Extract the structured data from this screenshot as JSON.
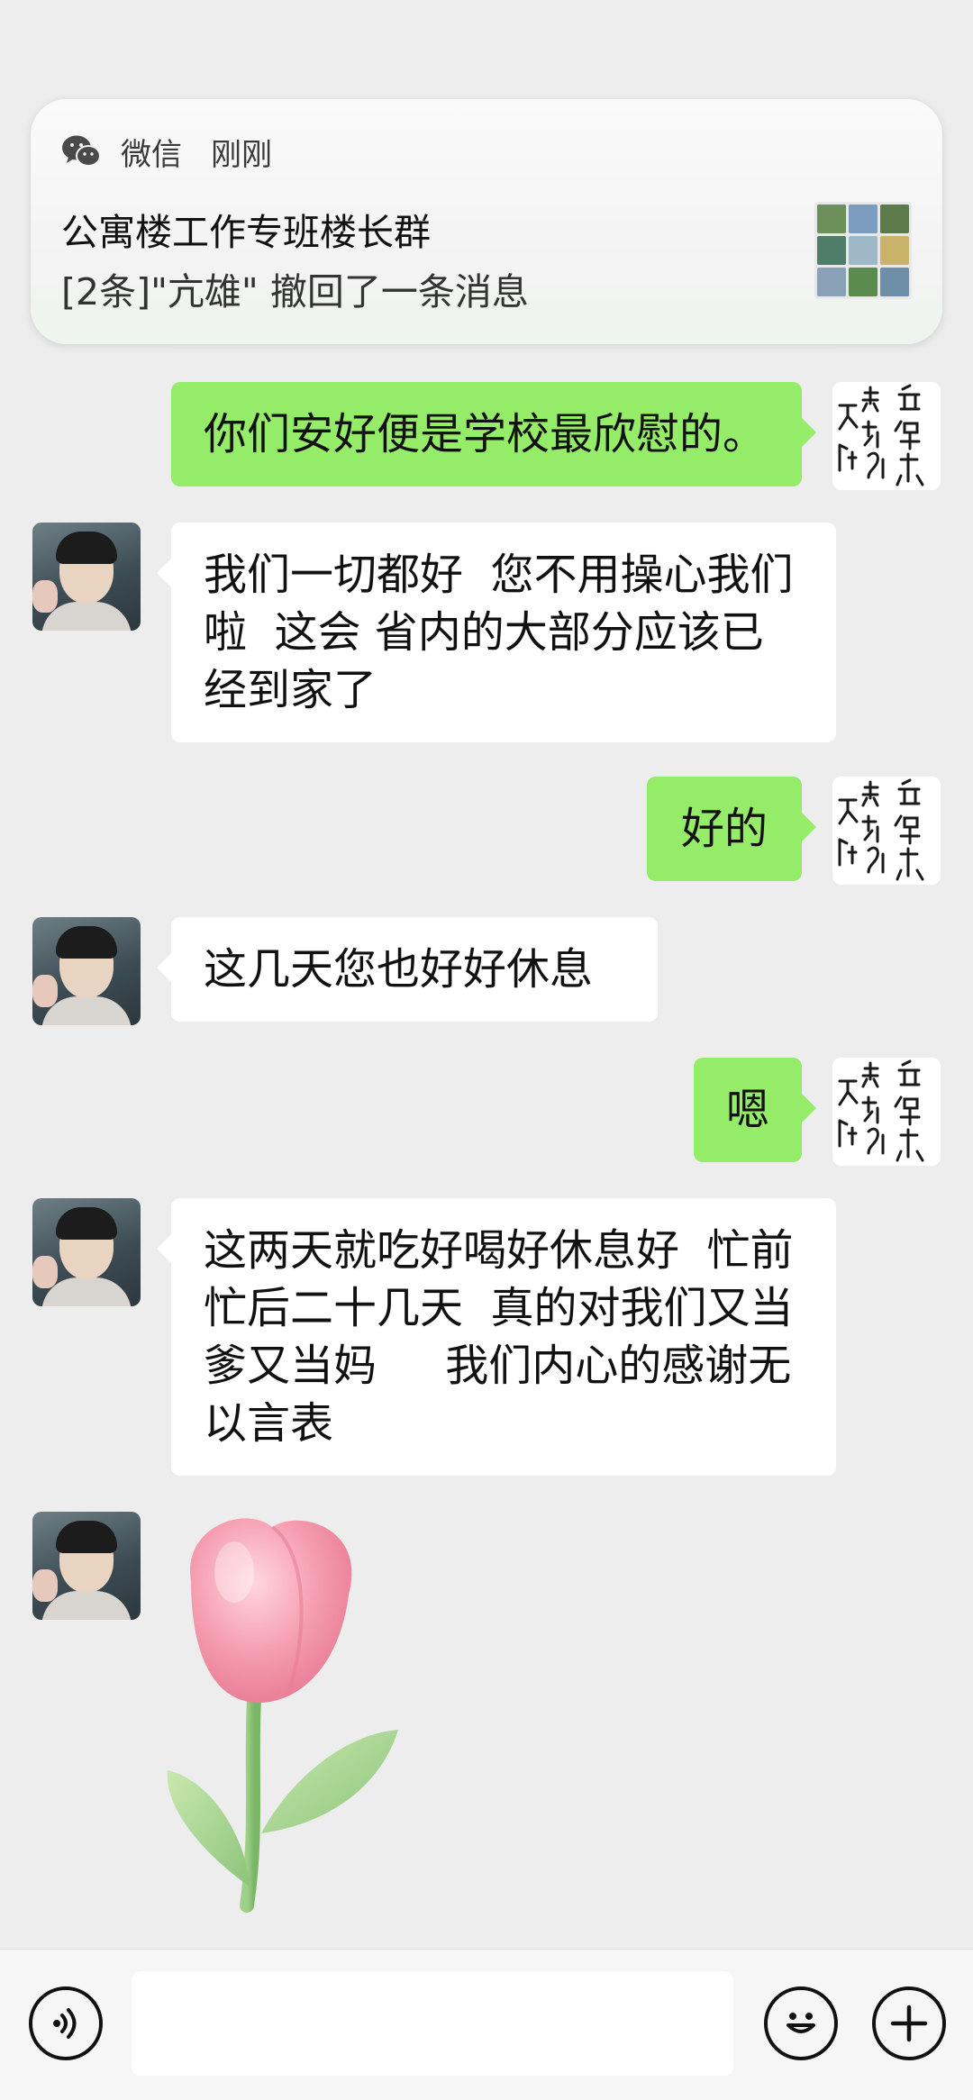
{
  "notification": {
    "app_name": "微信",
    "time": "刚刚",
    "title": "公寓楼工作专班楼长群",
    "body": "[2条]\"亢雄\" 撤回了一条消息",
    "app_icon": "wechat-icon",
    "thumbnail_colors": [
      "#6d8f5a",
      "#7b9bbf",
      "#5d7a4a",
      "#4f7d6a",
      "#9fb8c8",
      "#c9b26a",
      "#8aa0b6",
      "#5a8a4e",
      "#6f8fa8"
    ]
  },
  "messages": [
    {
      "side": "out",
      "text": "你们安好便是学校最欣慰的。"
    },
    {
      "side": "in",
      "text": "我们一切都好  您不用操心我们\n啦  这会 省内的大部分应该已\n经到家了"
    },
    {
      "side": "out",
      "text": "好的"
    },
    {
      "side": "in",
      "text": "这几天您也好好休息"
    },
    {
      "side": "out",
      "text": "嗯"
    },
    {
      "side": "in",
      "text": "这两天就吃好喝好休息好  忙前\n忙后二十几天  真的对我们又当\n爹又当妈     我们内心的感谢无\n以言表"
    },
    {
      "side": "in",
      "type": "sticker",
      "sticker": "tulip-sticker"
    }
  ],
  "input_bar": {
    "voice_icon": "voice-icon",
    "emoji_icon": "emoji-icon",
    "plus_icon": "plus-icon",
    "input_value": ""
  },
  "colors": {
    "background": "#ededed",
    "outgoing_bubble": "#95ec69",
    "incoming_bubble": "#ffffff"
  }
}
